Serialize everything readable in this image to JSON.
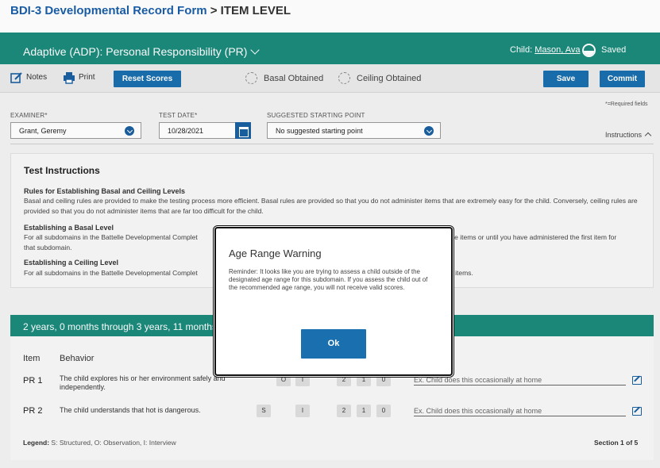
{
  "header": {
    "breadcrumb_link": "BDI-3 Developmental Record Form",
    "breadcrumb_sep": " > ",
    "breadcrumb_current": "ITEM LEVEL"
  },
  "domain_bar": {
    "title": "Adaptive (ADP): Personal Responsibility (PR)",
    "child_label": "Child: ",
    "child_name": "Mason, Ava",
    "saved_label": "Saved"
  },
  "toolbar": {
    "notes_label": "Notes",
    "print_label": "Print",
    "reset_label": "Reset Scores",
    "basal_label": "Basal Obtained",
    "ceiling_label": "Ceiling Obtained",
    "save_label": "Save",
    "commit_label": "Commit"
  },
  "form": {
    "required_note": "*=Required fields",
    "examiner_label": "EXAMINER*",
    "examiner_value": "Grant, Geremy",
    "test_date_label": "TEST DATE*",
    "test_date_value": "10/28/2021",
    "start_point_label": "SUGGESTED STARTING POINT",
    "start_point_value": "No suggested starting point",
    "instructions_toggle": "Instructions"
  },
  "instructions": {
    "title": "Test Instructions",
    "basal_ceiling_heading": "Rules for Establishing Basal and Ceiling Levels",
    "basal_ceiling_text": "Basal and ceiling rules are provided to make the testing process more efficient. Basal rules are provided so that you do not administer items that are extremely easy for the child. Conversely, ceiling rules are provided so that you do not administer items that are far too difficult for the child.",
    "basal_heading": "Establishing a Basal Level",
    "basal_text_left": "For all subdomains in the Battelle Developmental Complet",
    "basal_text_right": "ive items or until you have administered the first item for",
    "basal_text_line2": "that subdomain.",
    "ceiling_heading": "Establishing a Ceiling Level",
    "ceiling_text_left": "For all subdomains in the Battelle Developmental Complet",
    "ceiling_text_right": "e items."
  },
  "age_band": {
    "label": "2 years, 0 months through 3 years, 11 months"
  },
  "items_table": {
    "col_item": "Item",
    "col_behavior": "Behavior",
    "rows": [
      {
        "id": "PR 1",
        "behavior": "The child explores his or her environment safely and independently.",
        "methods": [
          "O",
          "I"
        ],
        "scores": [
          "2",
          "1",
          "0"
        ],
        "note_placeholder": "Ex. Child does this occasionally at home"
      },
      {
        "id": "PR 2",
        "behavior": "The child understands that hot is dangerous.",
        "methods": [
          "S",
          "I"
        ],
        "scores": [
          "2",
          "1",
          "0"
        ],
        "note_placeholder": "Ex. Child does this occasionally at home"
      }
    ],
    "legend_label": "Legend:",
    "legend_text": " S: Structured, O: Observation, I: Interview",
    "section_label": "Section 1 of 5"
  },
  "modal": {
    "title": "Age Range Warning",
    "body": "Reminder: It looks like you are trying to assess a child outside of the designated age range for this subdomain. If you assess the child out of the recommended age range, you will not receive valid scores.",
    "ok_label": "Ok"
  },
  "colors": {
    "teal": "#1c8a7c",
    "primary_blue": "#1a6fae",
    "link_blue": "#1b5ea8"
  }
}
